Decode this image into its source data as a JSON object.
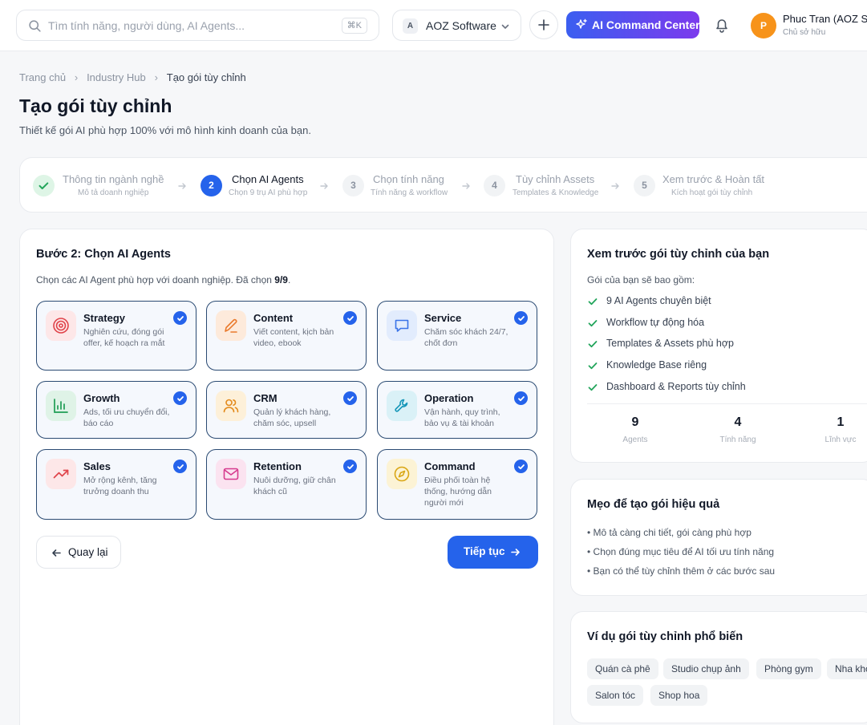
{
  "topbar": {
    "search_placeholder": "Tìm tính năng, người dùng, AI Agents...",
    "search_shortcut": "⌘K",
    "org_badge": "A",
    "org_name": "AOZ Software",
    "ai_command_label": "AI Command Center",
    "user_initial": "P",
    "user_name": "Phuc Tran (AOZ Software)",
    "user_role": "Chủ sở hữu"
  },
  "breadcrumb": {
    "items": [
      "Trang chủ",
      "Industry Hub"
    ],
    "current": "Tạo gói tùy chỉnh"
  },
  "page": {
    "title": "Tạo gói tùy chỉnh",
    "subtitle": "Thiết kế gói AI phù hợp 100% với mô hình kinh doanh của bạn."
  },
  "stepper": {
    "steps": [
      {
        "number": "1",
        "title": "Thông tin ngành nghề",
        "subtitle": "Mô tả doanh nghiệp",
        "state": "done"
      },
      {
        "number": "2",
        "title": "Chọn AI Agents",
        "subtitle": "Chọn 9 trụ AI phù hợp",
        "state": "active"
      },
      {
        "number": "3",
        "title": "Chọn tính năng",
        "subtitle": "Tính năng & workflow",
        "state": "pending"
      },
      {
        "number": "4",
        "title": "Tùy chỉnh Assets",
        "subtitle": "Templates & Knowledge",
        "state": "pending"
      },
      {
        "number": "5",
        "title": "Xem trước & Hoàn tất",
        "subtitle": "Kích hoạt gói tùy chỉnh",
        "state": "pending"
      }
    ]
  },
  "agents_section": {
    "title": "Bước 2: Chọn AI Agents",
    "description_prefix": "Chọn các AI Agent phù hợp với doanh nghiệp. Đã chọn ",
    "selected_count": "9/9",
    "description_suffix": ".",
    "agents": [
      {
        "name": "Strategy",
        "description": "Nghiên cứu, đóng gói offer, kế hoạch ra mắt",
        "icon": "target-icon",
        "color": "#e0434a",
        "selected": true
      },
      {
        "name": "Content",
        "description": "Viết content, kịch bản video, ebook",
        "icon": "pen-icon",
        "color": "#ea7a2c",
        "selected": true
      },
      {
        "name": "Service",
        "description": "Chăm sóc khách 24/7, chốt đơn",
        "icon": "chat-icon",
        "color": "#3b74e8",
        "selected": true
      },
      {
        "name": "Growth",
        "description": "Ads, tối ưu chuyển đổi, báo cáo",
        "icon": "bar-chart-icon",
        "color": "#1f9d55",
        "selected": true
      },
      {
        "name": "CRM",
        "description": "Quản lý khách hàng, chăm sóc, upsell",
        "icon": "users-icon",
        "color": "#e38a1c",
        "selected": true
      },
      {
        "name": "Operation",
        "description": "Vận hành, quy trình, bảo vụ & tài khoản",
        "icon": "wrench-icon",
        "color": "#1596b8",
        "selected": true
      },
      {
        "name": "Sales",
        "description": "Mở rộng kênh, tăng trưởng doanh thu",
        "icon": "trend-up-icon",
        "color": "#e0434a",
        "selected": true
      },
      {
        "name": "Retention",
        "description": "Nuôi dưỡng, giữ chân khách cũ",
        "icon": "mail-icon",
        "color": "#d63b8e",
        "selected": true
      },
      {
        "name": "Command",
        "description": "Điều phối toàn hệ thống, hướng dẫn người mới",
        "icon": "compass-icon",
        "color": "#d9a614",
        "selected": true
      }
    ],
    "back_label": "Quay lại",
    "next_label": "Tiếp tục"
  },
  "preview": {
    "title": "Xem trước gói tùy chỉnh của bạn",
    "lead": "Gói của bạn sẽ bao gồm:",
    "includes": [
      "9 AI Agents chuyên biệt",
      "Workflow tự động hóa",
      "Templates & Assets phù hợp",
      "Knowledge Base riêng",
      "Dashboard & Reports tùy chỉnh"
    ],
    "stats": [
      {
        "value": "9",
        "label": "Agents"
      },
      {
        "value": "4",
        "label": "Tính năng"
      },
      {
        "value": "1",
        "label": "Lĩnh vực"
      }
    ]
  },
  "tips": {
    "title": "Mẹo để tạo gói hiệu quả",
    "items": [
      "• Mô tả càng chi tiết, gói càng phù hợp",
      "• Chọn đúng mục tiêu để AI tối ưu tính năng",
      "• Bạn có thể tùy chỉnh thêm ở các bước sau"
    ]
  },
  "examples": {
    "title": "Ví dụ gói tùy chỉnh phổ biến",
    "chips": [
      "Quán cà phê",
      "Studio chụp ảnh",
      "Phòng gym",
      "Nha khoa",
      "Salon tóc",
      "Shop hoa"
    ]
  },
  "colors": {
    "primary": "#2563eb",
    "success": "#22a55b",
    "ai_gradient_start": "#3b5ef0",
    "ai_gradient_end": "#7c3aed",
    "avatar": "#f7931a"
  }
}
